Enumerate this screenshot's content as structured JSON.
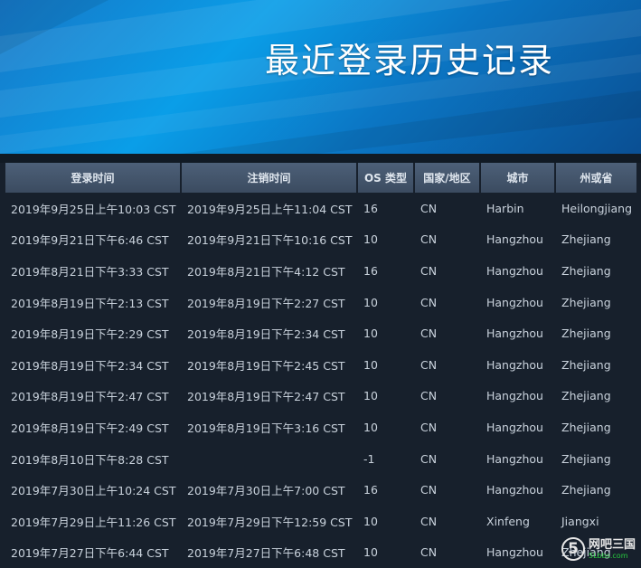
{
  "banner": {
    "title": "最近登录历史记录"
  },
  "table": {
    "headers": [
      "登录时间",
      "注销时间",
      "OS 类型",
      "国家/地区",
      "城市",
      "州或省"
    ],
    "rows": [
      [
        "2019年9月25日上午10:03 CST",
        "2019年9月25日上午11:04 CST",
        "16",
        "CN",
        "Harbin",
        "Heilongjiang"
      ],
      [
        "2019年9月21日下午6:46 CST",
        "2019年9月21日下午10:16 CST",
        "10",
        "CN",
        "Hangzhou",
        "Zhejiang"
      ],
      [
        "2019年8月21日下午3:33 CST",
        "2019年8月21日下午4:12 CST",
        "16",
        "CN",
        "Hangzhou",
        "Zhejiang"
      ],
      [
        "2019年8月19日下午2:13 CST",
        "2019年8月19日下午2:27 CST",
        "10",
        "CN",
        "Hangzhou",
        "Zhejiang"
      ],
      [
        "2019年8月19日下午2:29 CST",
        "2019年8月19日下午2:34 CST",
        "10",
        "CN",
        "Hangzhou",
        "Zhejiang"
      ],
      [
        "2019年8月19日下午2:34 CST",
        "2019年8月19日下午2:45 CST",
        "10",
        "CN",
        "Hangzhou",
        "Zhejiang"
      ],
      [
        "2019年8月19日下午2:47 CST",
        "2019年8月19日下午2:47 CST",
        "10",
        "CN",
        "Hangzhou",
        "Zhejiang"
      ],
      [
        "2019年8月19日下午2:49 CST",
        "2019年8月19日下午3:16 CST",
        "10",
        "CN",
        "Hangzhou",
        "Zhejiang"
      ],
      [
        "2019年8月10日下午8:28 CST",
        "",
        "-1",
        "CN",
        "Hangzhou",
        "Zhejiang"
      ],
      [
        "2019年7月30日上午10:24 CST",
        "2019年7月30日上午7:00 CST",
        "16",
        "CN",
        "Hangzhou",
        "Zhejiang"
      ],
      [
        "2019年7月29日上午11:26 CST",
        "2019年7月29日下午12:59 CST",
        "10",
        "CN",
        "Xinfeng",
        "Jiangxi"
      ],
      [
        "2019年7月27日下午6:44 CST",
        "2019年7月27日下午6:48 CST",
        "10",
        "CN",
        "Hangzhou",
        "Zhejiang"
      ]
    ]
  },
  "watermark": {
    "logo_char": "5",
    "text": "网吧三国",
    "sub": "5Lbbs.com"
  },
  "colors": {
    "page_bg": "#17202c",
    "header_bg": "#44566c",
    "text": "#c9d2dc",
    "banner_blue": "#0a9ee8"
  }
}
